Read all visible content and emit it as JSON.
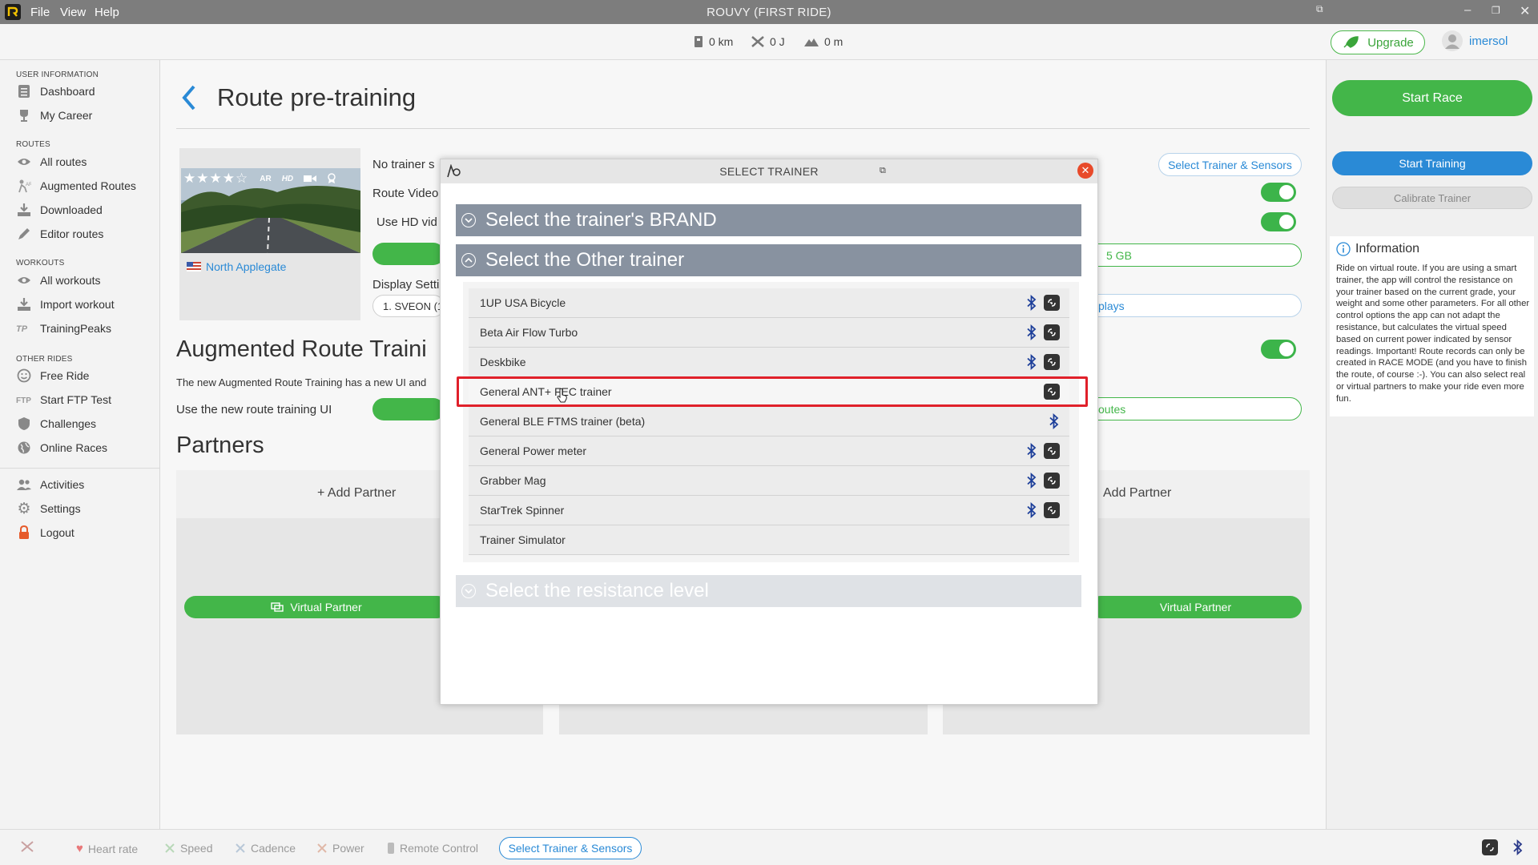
{
  "app": {
    "title": "ROUVY (FIRST RIDE)",
    "menu": [
      "File",
      "View",
      "Help"
    ]
  },
  "stats": {
    "distance": "0 km",
    "energy": "0 J",
    "elevation": "0 m"
  },
  "header": {
    "upgrade_label": "Upgrade",
    "user_name": "imersol"
  },
  "sidebar": {
    "sections": [
      {
        "title": "USER INFORMATION",
        "items": [
          {
            "label": "Dashboard",
            "icon": "dashboard-icon"
          },
          {
            "label": "My Career",
            "icon": "trophy-icon"
          }
        ]
      },
      {
        "title": "ROUTES",
        "items": [
          {
            "label": "All routes",
            "icon": "eye-icon"
          },
          {
            "label": "Augmented Routes",
            "icon": "ar-icon"
          },
          {
            "label": "Downloaded",
            "icon": "download-icon"
          },
          {
            "label": "Editor routes",
            "icon": "pencil-icon"
          }
        ]
      },
      {
        "title": "WORKOUTS",
        "items": [
          {
            "label": "All workouts",
            "icon": "eye-icon"
          },
          {
            "label": "Import workout",
            "icon": "import-icon"
          },
          {
            "label": "TrainingPeaks",
            "icon": "trainingpeaks-icon"
          }
        ]
      },
      {
        "title": "OTHER RIDES",
        "items": [
          {
            "label": "Free Ride",
            "icon": "smile-icon"
          },
          {
            "label": "Start FTP Test",
            "icon": "ftp-icon"
          },
          {
            "label": "Challenges",
            "icon": "shield-icon"
          },
          {
            "label": "Online Races",
            "icon": "globe-icon"
          }
        ]
      }
    ],
    "footer_items": [
      {
        "label": "Activities",
        "icon": "users-icon"
      },
      {
        "label": "Settings",
        "icon": "gear-icon"
      },
      {
        "label": "Logout",
        "icon": "lock-icon"
      }
    ]
  },
  "main": {
    "page_title": "Route pre-training",
    "route_name": "North Applegate",
    "route_rating": 4,
    "thumb_badges": [
      "AR",
      "HD"
    ],
    "labels": {
      "no_trainer": "No trainer s",
      "route_video": "Route Video",
      "use_hd": "Use HD vid",
      "display_settings": "Display Setti",
      "display_value": "1. SVEON (1",
      "gb_fragment": "5 GB",
      "plays_fragment": "plays",
      "routes_fragment": "outes"
    },
    "select_trainer_label": "Select Trainer & Sensors",
    "augmented_title": "Augmented Route Traini",
    "augmented_desc": "The new Augmented Route Training has a new UI and",
    "new_ui_label": "Use the new route training UI",
    "partners_title": "Partners",
    "add_partner": "+ Add Partner",
    "add_partner_right": "Add Partner",
    "virtual_partner": "Virtual Partner"
  },
  "right_panel": {
    "start_race": "Start Race",
    "start_training": "Start Training",
    "calibrate": "Calibrate Trainer",
    "info_title": "Information",
    "info_text": "Ride on virtual route. If you are using a smart trainer, the app will control the resistance on your trainer based on the current grade, your weight and some other parameters. For all other control options the app can not adapt the resistance, but calculates the virtual speed based on current power indicated by sensor readings. Important! Route records can only be created in RACE MODE (and you have to finish the route, of course :-). You can also select real or virtual partners to  make your ride even more fun."
  },
  "bottom_bar": {
    "items": [
      "Heart rate",
      "Speed",
      "Cadence",
      "Power",
      "Remote Control"
    ],
    "select_label": "Select Trainer & Sensors"
  },
  "dialog": {
    "title": "SELECT TRAINER",
    "sections": [
      "Select the trainer's BRAND",
      "Select the Other trainer",
      "Select the resistance level"
    ],
    "trainers": [
      {
        "name": "1UP USA Bicycle",
        "bluetooth": true,
        "ant": true
      },
      {
        "name": "Beta Air Flow Turbo",
        "bluetooth": true,
        "ant": true
      },
      {
        "name": "Deskbike",
        "bluetooth": true,
        "ant": true
      },
      {
        "name": "General ANT+ FEC trainer",
        "bluetooth": false,
        "ant": true
      },
      {
        "name": "General BLE FTMS trainer (beta)",
        "bluetooth": true,
        "ant": false
      },
      {
        "name": "General Power meter",
        "bluetooth": true,
        "ant": true
      },
      {
        "name": "Grabber Mag",
        "bluetooth": true,
        "ant": true
      },
      {
        "name": "StarTrek Spinner",
        "bluetooth": true,
        "ant": true
      },
      {
        "name": "Trainer Simulator",
        "bluetooth": false,
        "ant": false
      }
    ],
    "highlighted_index": 3
  },
  "colors": {
    "accent_green": "#43b649",
    "accent_blue": "#2a8ad6",
    "highlight_red": "#e0202a",
    "accordion_header": "#8892a0"
  }
}
